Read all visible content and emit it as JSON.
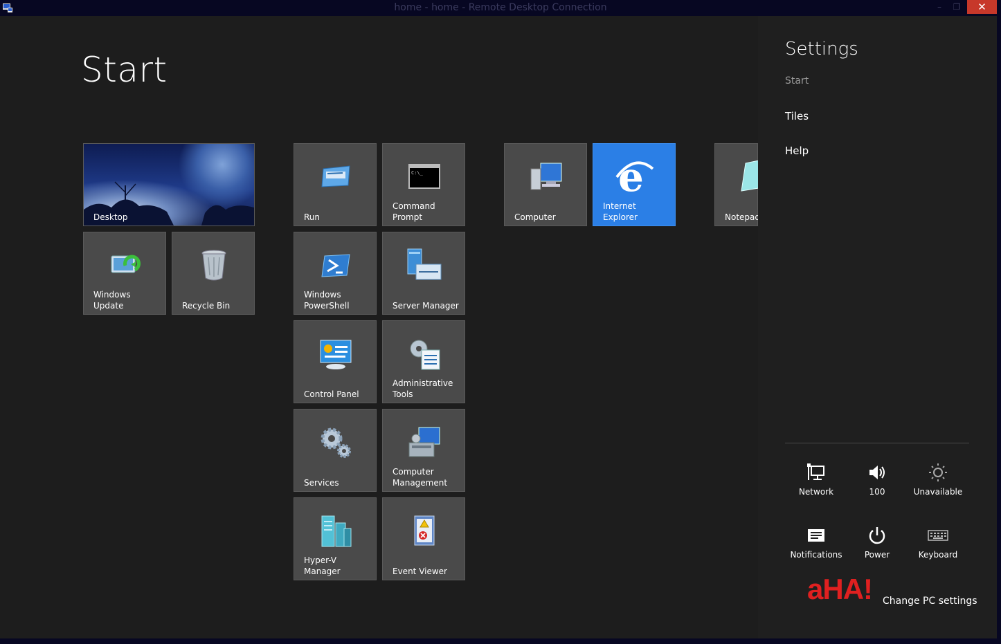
{
  "window": {
    "title": "home - home - Remote Desktop Connection",
    "minimize": "–",
    "maximize": "❐",
    "close": "✕"
  },
  "start": {
    "title": "Start"
  },
  "tiles": {
    "desktop": "Desktop",
    "windows_update": "Windows Update",
    "recycle_bin": "Recycle Bin",
    "run": "Run",
    "command_prompt_1": "Command",
    "command_prompt_2": "Prompt",
    "powershell_1": "Windows",
    "powershell_2": "PowerShell",
    "server_manager": "Server Manager",
    "control_panel": "Control Panel",
    "admin_tools_1": "Administrative",
    "admin_tools_2": "Tools",
    "services": "Services",
    "computer_mgmt_1": "Computer",
    "computer_mgmt_2": "Management",
    "hyperv_1": "Hyper-V",
    "hyperv_2": "Manager",
    "event_viewer": "Event Viewer",
    "computer": "Computer",
    "internet_explorer": "Internet Explorer",
    "notepad": "Notepad"
  },
  "settings": {
    "heading": "Settings",
    "context": "Start",
    "links": [
      "Tiles",
      "Help"
    ],
    "quick": {
      "network": "Network",
      "volume": "100",
      "brightness": "Unavailable",
      "notifications": "Notifications",
      "power": "Power",
      "keyboard": "Keyboard"
    },
    "watermark": "aHA!",
    "change_pc": "Change PC settings"
  },
  "colors": {
    "background": "#1d1d1d",
    "tile": "#4a4a4a",
    "ie_tile": "#2b7fe6",
    "close_button": "#c7382a",
    "watermark": "#e02020"
  }
}
